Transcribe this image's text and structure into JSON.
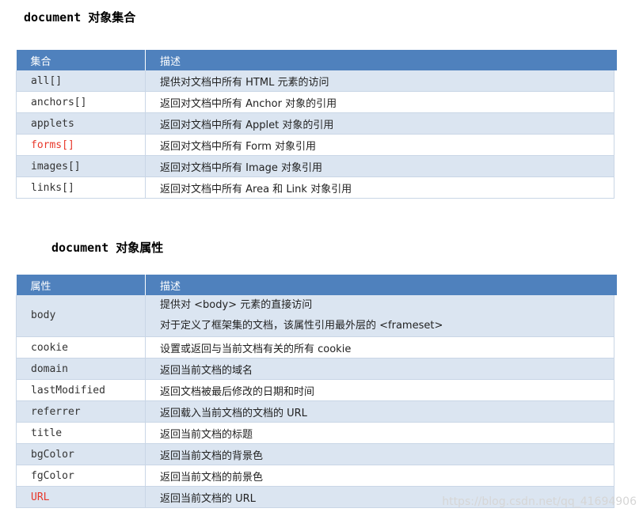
{
  "sections": [
    {
      "heading_code": "document",
      "heading_text": "对象集合",
      "columns": [
        "集合",
        "描述"
      ],
      "rows": [
        {
          "name": "all[]",
          "desc": "提供对文档中所有 HTML 元素的访问"
        },
        {
          "name": "anchors[]",
          "desc": "返回对文档中所有 Anchor 对象的引用"
        },
        {
          "name": "applets",
          "desc": "返回对文档中所有 Applet 对象的引用"
        },
        {
          "name": "forms[]",
          "desc": "返回对文档中所有 Form 对象引用"
        },
        {
          "name": "images[]",
          "desc": "返回对文档中所有 Image 对象引用"
        },
        {
          "name": "links[]",
          "desc": "返回对文档中所有 Area 和 Link 对象引用"
        }
      ]
    },
    {
      "heading_code": "document",
      "heading_text": "对象属性",
      "columns": [
        "属性",
        "描述"
      ],
      "rows": [
        {
          "name": "body",
          "desc": "提供对 <body> 元素的直接访问",
          "desc2": "对于定义了框架集的文档，该属性引用最外层的 <frameset>"
        },
        {
          "name": "cookie",
          "desc": "设置或返回与当前文档有关的所有 cookie"
        },
        {
          "name": "domain",
          "desc": "返回当前文档的域名"
        },
        {
          "name": "lastModified",
          "desc": "返回文档被最后修改的日期和时间"
        },
        {
          "name": "referrer",
          "desc": "返回载入当前文档的文档的 URL"
        },
        {
          "name": "title",
          "desc": "返回当前文档的标题"
        },
        {
          "name": "bgColor",
          "desc": "返回当前文档的背景色"
        },
        {
          "name": "fgColor",
          "desc": "返回当前文档的前景色"
        },
        {
          "name": "URL",
          "desc": "返回当前文档的 URL"
        }
      ]
    }
  ],
  "watermark": "https://blog.csdn.net/qq_41694906",
  "colors": {
    "header_bg": "#4f81bd",
    "alt_row_bg": "#dbe5f1",
    "highlight": "#e8382b"
  }
}
